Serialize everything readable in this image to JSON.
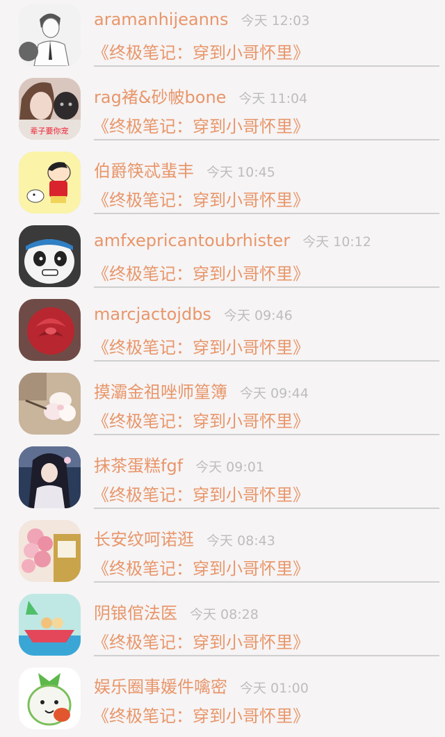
{
  "messages": [
    {
      "name": "aramanhijeanns",
      "time": "今天 12:03",
      "title": "《终极笔记：穿到小哥怀里》",
      "avatar": "sketch-man",
      "avatar_text": ""
    },
    {
      "name": "rag褚&砂帔bone",
      "time": "今天 11:04",
      "title": "《终极笔记：穿到小哥怀里》",
      "avatar": "girl-cat",
      "avatar_text": "辈子要你宠"
    },
    {
      "name": "伯爵筷忒蜚丰",
      "time": "今天 10:45",
      "title": "《终极笔记：穿到小哥怀里》",
      "avatar": "crayon-boy",
      "avatar_text": ""
    },
    {
      "name": "amfxepricantoubrhister",
      "time": "今天 10:12",
      "title": "《终极笔记：穿到小哥怀里》",
      "avatar": "panda",
      "avatar_text": ""
    },
    {
      "name": "marcjactojdbs",
      "time": "今天 09:46",
      "title": "《终极笔记：穿到小哥怀里》",
      "avatar": "red-rose",
      "avatar_text": ""
    },
    {
      "name": "摸灞金祖唑师篁簿",
      "time": "今天 09:44",
      "title": "《终极笔记：穿到小哥怀里》",
      "avatar": "white-flower",
      "avatar_text": ""
    },
    {
      "name": "抹茶蛋糕fgf",
      "time": "今天 09:01",
      "title": "《终极笔记：穿到小哥怀里》",
      "avatar": "anime-girl",
      "avatar_text": ""
    },
    {
      "name": "长安纹呵诺逛",
      "time": "今天 08:43",
      "title": "《终极笔记：穿到小哥怀里》",
      "avatar": "pink-balloons",
      "avatar_text": ""
    },
    {
      "name": "阴锒倌法医",
      "time": "今天 08:28",
      "title": "《终极笔记：穿到小哥怀里》",
      "avatar": "boat-cartoon",
      "avatar_text": ""
    },
    {
      "name": "娱乐圈事媛件噙密",
      "time": "今天 01:00",
      "title": "《终极笔记：穿到小哥怀里》",
      "avatar": "cartoon-fruit",
      "avatar_text": ""
    }
  ],
  "colors": {
    "accent": "#e8966a",
    "time": "#bdbdbd",
    "divider": "#cfcfcf",
    "background": "#f6f4f5"
  }
}
